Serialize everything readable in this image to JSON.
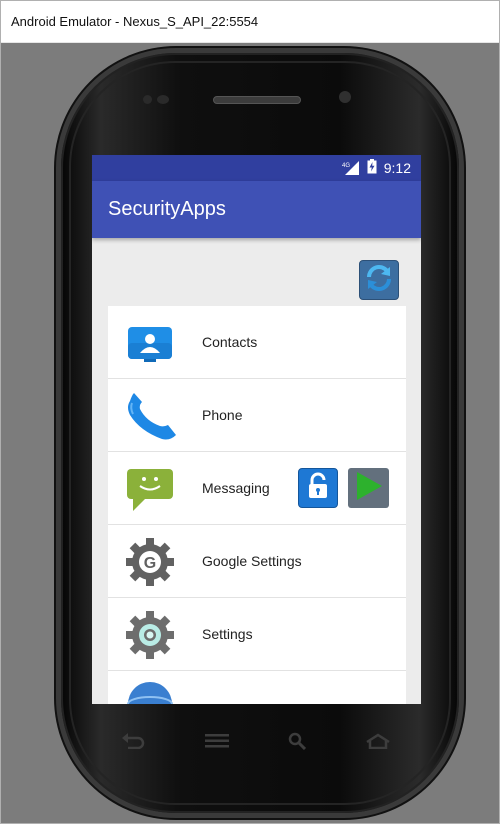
{
  "window": {
    "title": "Android Emulator - Nexus_S_API_22:5554"
  },
  "statusbar": {
    "network": "4G",
    "time": "9:12"
  },
  "appbar": {
    "title": "SecurityApps"
  },
  "apps": [
    {
      "name": "Contacts",
      "icon": "contacts-icon"
    },
    {
      "name": "Phone",
      "icon": "phone-icon"
    },
    {
      "name": "Messaging",
      "icon": "messaging-icon"
    },
    {
      "name": "Google Settings",
      "icon": "google-settings-icon"
    },
    {
      "name": "Settings",
      "icon": "settings-icon"
    },
    {
      "name": "",
      "icon": "globe-icon"
    }
  ],
  "nav_keys": [
    "back-key-icon",
    "menu-key-icon",
    "search-key-icon",
    "home-key-icon"
  ],
  "colors": {
    "appbar": "#3f51b5",
    "statusbar": "#303f9f",
    "lock_button": "#1e78d4",
    "play": "#2db12d"
  }
}
